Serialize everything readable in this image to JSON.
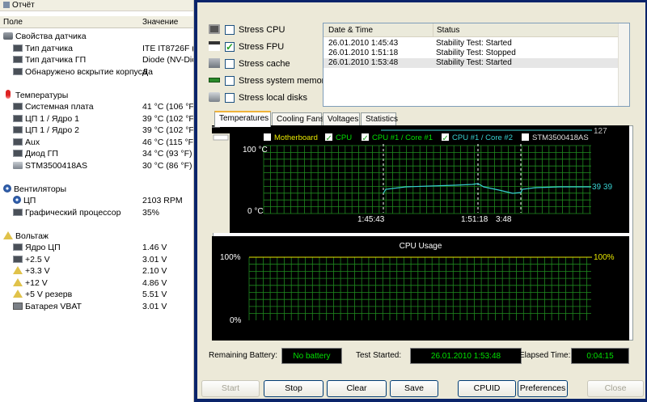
{
  "left": {
    "title": "Отчёт",
    "col_field": "Поле",
    "col_value": "Значение",
    "rows": [
      {
        "indent": 0,
        "icon": "sensor-icon",
        "name": "Свойства датчика",
        "value": ""
      },
      {
        "indent": 1,
        "icon": "chip-icon",
        "name": "Тип датчика",
        "value": "ITE IT8726F  (I"
      },
      {
        "indent": 1,
        "icon": "chip-icon",
        "name": "Тип датчика ГП",
        "value": "Diode  (NV-Diod"
      },
      {
        "indent": 1,
        "icon": "chip-icon",
        "name": "Обнаружено вскрытие корпуса",
        "value": "Да"
      },
      {
        "indent": 0,
        "icon": "",
        "name": "",
        "value": ""
      },
      {
        "indent": 0,
        "icon": "thermometer-icon",
        "name": "Температуры",
        "value": ""
      },
      {
        "indent": 1,
        "icon": "chip-icon",
        "name": "Системная плата",
        "value": "41 °C  (106 °F)"
      },
      {
        "indent": 1,
        "icon": "chip-icon",
        "name": "ЦП 1 / Ядро 1",
        "value": "39 °C  (102 °F)"
      },
      {
        "indent": 1,
        "icon": "chip-icon",
        "name": "ЦП 1 / Ядро 2",
        "value": "39 °C  (102 °F)"
      },
      {
        "indent": 1,
        "icon": "chip-icon",
        "name": "Aux",
        "value": "46 °C  (115 °F)"
      },
      {
        "indent": 1,
        "icon": "chip-icon",
        "name": "Диод ГП",
        "value": "34 °C  (93 °F)"
      },
      {
        "indent": 1,
        "icon": "disk-icon",
        "name": "STM3500418AS",
        "value": "30 °C  (86 °F)"
      },
      {
        "indent": 0,
        "icon": "",
        "name": "",
        "value": ""
      },
      {
        "indent": 0,
        "icon": "fan-icon",
        "name": "Вентиляторы",
        "value": ""
      },
      {
        "indent": 1,
        "icon": "fan-icon",
        "name": "ЦП",
        "value": "2103 RPM"
      },
      {
        "indent": 1,
        "icon": "chip-icon",
        "name": "Графический процессор",
        "value": "35%"
      },
      {
        "indent": 0,
        "icon": "",
        "name": "",
        "value": ""
      },
      {
        "indent": 0,
        "icon": "voltage-icon",
        "name": "Вольтаж",
        "value": ""
      },
      {
        "indent": 1,
        "icon": "chip-icon",
        "name": "Ядро ЦП",
        "value": "1.46 V"
      },
      {
        "indent": 1,
        "icon": "chip-icon",
        "name": "+2.5 V",
        "value": "3.01 V"
      },
      {
        "indent": 1,
        "icon": "voltage-icon",
        "name": "+3.3 V",
        "value": "2.10 V"
      },
      {
        "indent": 1,
        "icon": "voltage-icon",
        "name": "+12 V",
        "value": "4.86 V"
      },
      {
        "indent": 1,
        "icon": "voltage-icon",
        "name": "+5 V резерв",
        "value": "5.51 V"
      },
      {
        "indent": 1,
        "icon": "battery-icon",
        "name": "Батарея VBAT",
        "value": "3.01 V"
      }
    ]
  },
  "stress": {
    "options": [
      {
        "label": "Stress CPU",
        "checked": false,
        "icon": "cpu-icon"
      },
      {
        "label": "Stress FPU",
        "checked": true,
        "icon": "fpu-icon"
      },
      {
        "label": "Stress cache",
        "checked": false,
        "icon": "cache-icon"
      },
      {
        "label": "Stress system memory",
        "checked": false,
        "icon": "memory-icon"
      },
      {
        "label": "Stress local disks",
        "checked": false,
        "icon": "disk-icon"
      }
    ]
  },
  "log": {
    "col_date": "Date & Time",
    "col_status": "Status",
    "rows": [
      {
        "date": "26.01.2010 1:45:43",
        "status": "Stability Test: Started"
      },
      {
        "date": "26.01.2010 1:51:18",
        "status": "Stability Test: Stopped"
      },
      {
        "date": "26.01.2010 1:53:48",
        "status": "Stability Test: Started"
      }
    ]
  },
  "tabs": [
    "Temperatures",
    "Cooling Fans",
    "Voltages",
    "Statistics"
  ],
  "temp_graph": {
    "legend": [
      {
        "label": "Motherboard",
        "checked": false,
        "color": "#e8e800"
      },
      {
        "label": "CPU",
        "checked": true,
        "color": "#00e000"
      },
      {
        "label": "CPU #1 / Core #1",
        "checked": true,
        "color": "#00e000"
      },
      {
        "label": "CPU #1 / Core #2",
        "checked": true,
        "color": "#38d0d0"
      },
      {
        "label": "STM3500418AS",
        "checked": false,
        "color": "#e0e0e0"
      }
    ],
    "top_value": "127",
    "y_top": "100 °C",
    "y_bottom": "0 °C",
    "x_label_1": "1:45:43",
    "x_label_2": "1:51:18",
    "x_label_3": "3:48",
    "right_values": "39 39",
    "line_color": "#38d0d0",
    "grid_color": "#1f8a1f"
  },
  "cpu_graph": {
    "title": "CPU Usage",
    "y_top": "100%",
    "y_bottom": "0%",
    "right_value": "100%",
    "right_color": "#e8e800"
  },
  "status_bar": {
    "battery_label": "Remaining Battery:",
    "battery_value": "No battery",
    "started_label": "Test Started:",
    "started_value": "26.01.2010 1:53:48",
    "elapsed_label": "Elapsed Time:",
    "elapsed_value": "0:04:15"
  },
  "buttons": {
    "start": "Start",
    "stop": "Stop",
    "clear": "Clear",
    "save": "Save",
    "cpuid": "CPUID",
    "preferences": "Preferences",
    "close": "Close"
  }
}
